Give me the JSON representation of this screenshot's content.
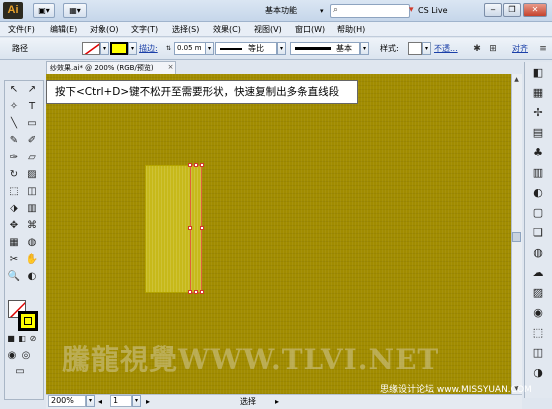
{
  "app": {
    "logo": "Ai"
  },
  "titlebar": {
    "workspace_label": "基本功能",
    "workspace_arrow": "▾",
    "search_icon": "⌕",
    "cslive_label": "CS Live",
    "cslive_arrow": "▾",
    "win_minimize": "‒",
    "win_restore": "❐",
    "win_close": "✕",
    "toolbar_buttons": [
      "▣▾",
      "▦▾"
    ]
  },
  "menu": {
    "items": [
      "文件(F)",
      "编辑(E)",
      "对象(O)",
      "文字(T)",
      "选择(S)",
      "效果(C)",
      "视图(V)",
      "窗口(W)",
      "帮助(H)"
    ]
  },
  "control": {
    "path_label": "路径",
    "stroke_label": "描边:",
    "stroke_weight": "0.05 m",
    "stroke_unit_arrow": "▾",
    "profile_label": "等比",
    "brush_label": "基本",
    "style_label": "样式:",
    "opacity_label": "不透...",
    "align_label": "对齐",
    "fill_color": "#ffffff",
    "stroke_color": "#ffff00"
  },
  "document": {
    "tab_title": "纱效果.ai* @ 200% (RGB/预览)",
    "close": "×"
  },
  "canvas": {
    "tip": "按下<Ctrl+D>键不松开至需要形状，快速复制出多条直线段",
    "watermark": "騰龍視覺WWW.TLVI.NET",
    "forum": "思缘设计论坛 www.MISSYUAN.COM",
    "bg_color": "#a18c00",
    "shape_color": "#c7b91a",
    "selection_color": "#e0603a"
  },
  "tools": {
    "icons": [
      "↖",
      "↗",
      "✧",
      "T",
      "╲",
      "▭",
      "✎",
      "✐",
      "✑",
      "▱",
      "↻",
      "▨",
      "⬚",
      "◫",
      "⬗",
      "▥",
      "✥",
      "⌘",
      "▦",
      "◍",
      "✂",
      "✋",
      "🔍",
      "◐"
    ],
    "fill_color": "#ffffff",
    "stroke_color": "#ffff00"
  },
  "panel": {
    "icons": [
      "◧",
      "▦",
      "✢",
      "▤",
      "♣",
      "▥",
      "◐",
      "▢",
      "❏",
      "◍",
      "☁",
      "▨",
      "◉",
      "⬚",
      "◫",
      "◑"
    ]
  },
  "statusbar": {
    "zoom": "200%",
    "page": "1",
    "mode": "选择",
    "arrow_left": "◂",
    "arrow_right": "▸"
  }
}
